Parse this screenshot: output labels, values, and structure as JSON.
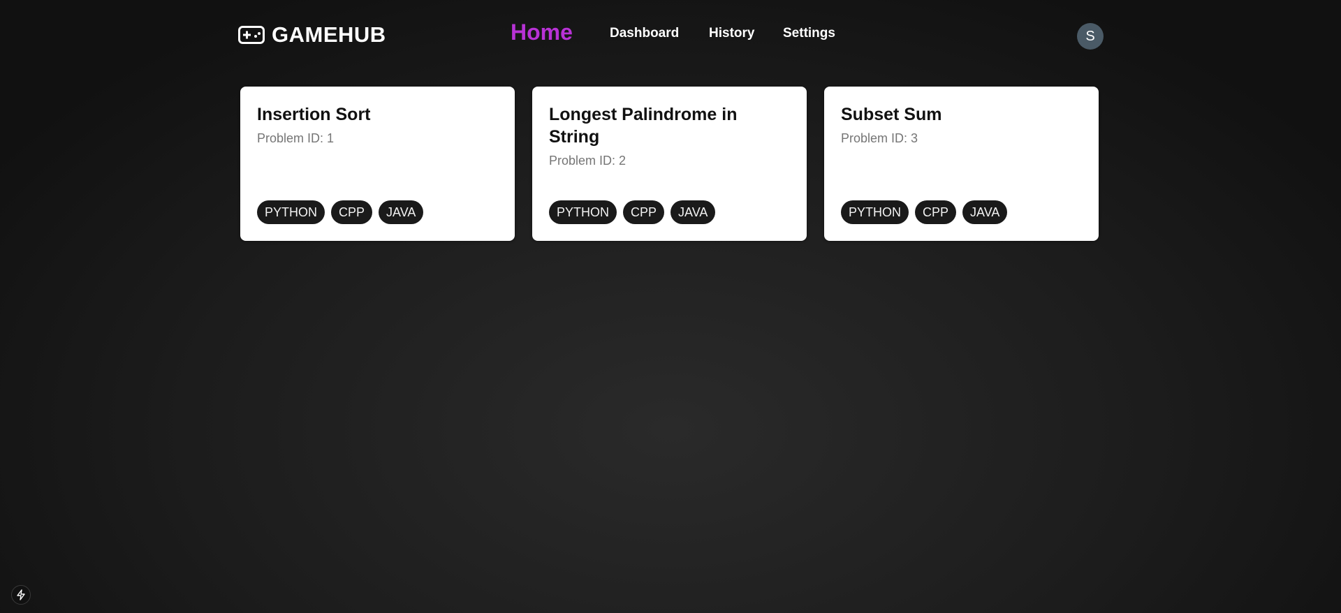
{
  "brand": {
    "name": "GAMEHUB",
    "icon": "gamepad-icon"
  },
  "nav": {
    "home": "Home",
    "dashboard": "Dashboard",
    "history": "History",
    "settings": "Settings"
  },
  "user": {
    "initial": "S"
  },
  "colors": {
    "accent": "#b832d6",
    "avatar_bg": "#4a5a66",
    "tag_bg": "#1a1a1a",
    "card_bg": "#ffffff"
  },
  "problems": [
    {
      "title": "Insertion Sort",
      "id_text": "Problem ID: 1",
      "tags": [
        "PYTHON",
        "CPP",
        "JAVA"
      ]
    },
    {
      "title": "Longest Palindrome in String",
      "id_text": "Problem ID: 2",
      "tags": [
        "PYTHON",
        "CPP",
        "JAVA"
      ]
    },
    {
      "title": "Subset Sum",
      "id_text": "Problem ID: 3",
      "tags": [
        "PYTHON",
        "CPP",
        "JAVA"
      ]
    }
  ],
  "corner_button": {
    "icon": "lightning-icon"
  }
}
